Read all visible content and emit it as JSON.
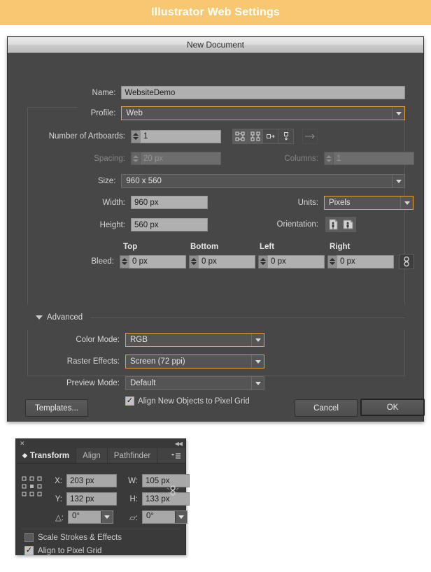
{
  "banner": {
    "title": "Illustrator Web Settings",
    "bg": "#f7c871"
  },
  "dialog": {
    "title": "New Document",
    "fields": {
      "name": {
        "label": "Name:",
        "value": "WebsiteDemo"
      },
      "profile": {
        "label": "Profile:",
        "value": "Web"
      },
      "artboards": {
        "label": "Number of Artboards:",
        "value": "1"
      },
      "spacing": {
        "label": "Spacing:",
        "value": "20 px"
      },
      "columns": {
        "label": "Columns:",
        "value": "1"
      },
      "size": {
        "label": "Size:",
        "value": "960 x 560"
      },
      "width": {
        "label": "Width:",
        "value": "960 px"
      },
      "height": {
        "label": "Height:",
        "value": "560 px"
      },
      "units": {
        "label": "Units:",
        "value": "Pixels"
      },
      "orientation": {
        "label": "Orientation:"
      },
      "bleed": {
        "label": "Bleed:",
        "columns": [
          "Top",
          "Bottom",
          "Left",
          "Right"
        ],
        "values": [
          "0 px",
          "0 px",
          "0 px",
          "0 px"
        ]
      }
    },
    "advanced": {
      "label": "Advanced",
      "color_mode": {
        "label": "Color Mode:",
        "value": "RGB"
      },
      "raster_effects": {
        "label": "Raster Effects:",
        "value": "Screen (72 ppi)"
      },
      "preview_mode": {
        "label": "Preview Mode:",
        "value": "Default"
      },
      "align_pixel_grid": {
        "label": "Align New Objects to Pixel Grid",
        "checked": true,
        "mark": "✓"
      }
    },
    "buttons": {
      "templates": "Templates...",
      "cancel": "Cancel",
      "ok": "OK"
    }
  },
  "transform_panel": {
    "close_glyph": "✕",
    "collapse_glyph": "◀◀",
    "menu_glyph": "≡",
    "tabs": [
      {
        "label": "Transform",
        "active": true
      },
      {
        "label": "Align",
        "active": false
      },
      {
        "label": "Pathfinder",
        "active": false
      }
    ],
    "fields": {
      "x": {
        "label": "X:",
        "value": "203 px"
      },
      "y": {
        "label": "Y:",
        "value": "132 px"
      },
      "w": {
        "label": "W:",
        "value": "105 px"
      },
      "h": {
        "label": "H:",
        "value": "133 px"
      },
      "rotate": {
        "label": "△:",
        "value": "0°"
      },
      "shear": {
        "label": "▱:",
        "value": "0°"
      }
    },
    "options": {
      "scale_strokes": {
        "label": "Scale Strokes & Effects",
        "checked": false
      },
      "align_pixel_grid": {
        "label": "Align to Pixel Grid",
        "checked": true,
        "mark": "✓"
      }
    }
  }
}
